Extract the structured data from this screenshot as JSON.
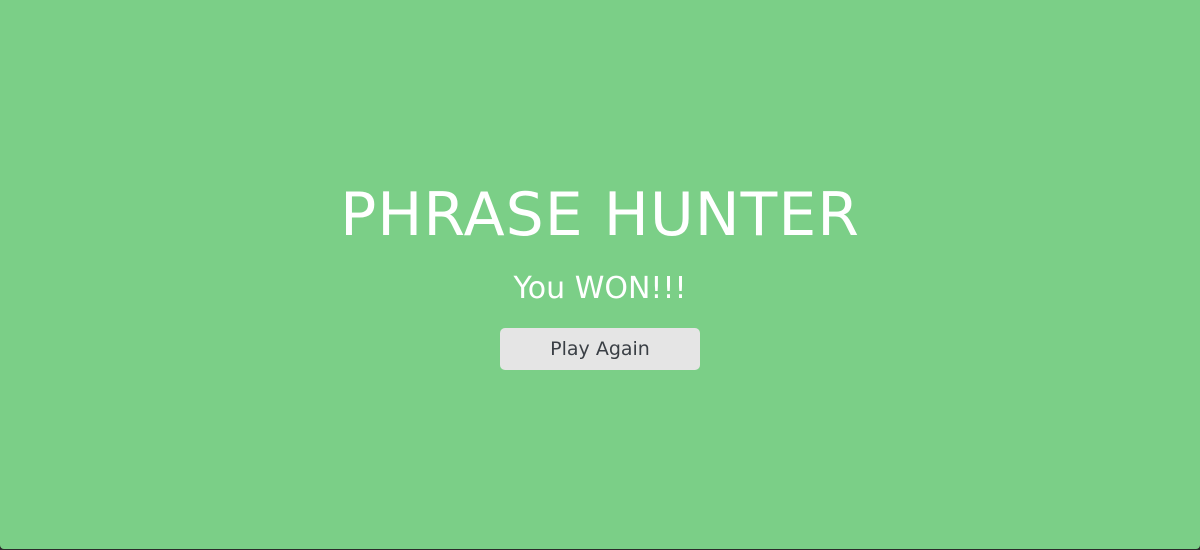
{
  "overlay": {
    "title": "PHRASE HUNTER",
    "message": "You WON!!!",
    "button_label": "Play Again"
  },
  "colors": {
    "background": "#7bcf87",
    "text": "#ffffff",
    "button_bg": "#e5e5e5",
    "button_text": "#3a3f45"
  }
}
